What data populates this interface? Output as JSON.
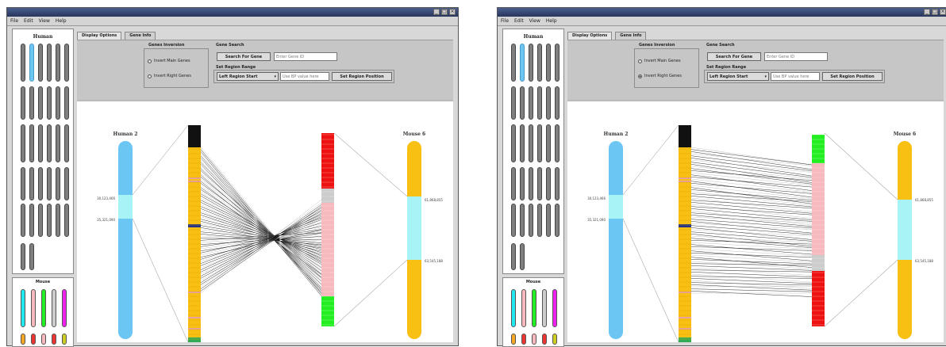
{
  "windows": [
    {
      "menu": [
        "File",
        "Edit",
        "View",
        "Help"
      ],
      "window_controls": [
        "_",
        "□",
        "×"
      ],
      "human_panel_title": "Human",
      "mouse_panel_title": "Mouse",
      "tabs": [
        "Display Options",
        "Gene Info"
      ],
      "gene_inversion": {
        "title": "Genes Inversion",
        "left": "Invert Main Genes",
        "right": "Invert Right Genes",
        "right_checked": false
      },
      "gene_search": {
        "title": "Gene Search",
        "button": "Search For Gene",
        "placeholder": "Enter Gene ID"
      },
      "region_range": {
        "title": "Set Region Range",
        "dropdown": "Left Region Start",
        "input_placeholder": "Use BP value here",
        "button": "Set Region Position"
      },
      "left_chromosome_label": "Human 2",
      "right_chromosome_label": "Mouse 6",
      "left_ticks": [
        "30,123,466",
        "35,321,090"
      ],
      "right_ticks": [
        "61,868,855",
        "63,545,188"
      ],
      "middle_right_order": "red-pink-green"
    },
    {
      "menu": [
        "File",
        "Edit",
        "View",
        "Help"
      ],
      "window_controls": [
        "_",
        "□",
        "×"
      ],
      "human_panel_title": "Human",
      "mouse_panel_title": "Mouse",
      "tabs": [
        "Display Options",
        "Gene Info"
      ],
      "gene_inversion": {
        "title": "Genes Inversion",
        "left": "Invert Main Genes",
        "right": "Invert Right Genes",
        "right_checked": true
      },
      "gene_search": {
        "title": "Gene Search",
        "button": "Search For Gene",
        "placeholder": "Enter Gene ID"
      },
      "region_range": {
        "title": "Set Region Range",
        "dropdown": "Left Region Start",
        "input_placeholder": "Use BP value here",
        "button": "Set Region Position"
      },
      "left_chromosome_label": "Human 2",
      "right_chromosome_label": "Mouse 6",
      "left_ticks": [
        "30,123,466",
        "35,321,090"
      ],
      "right_ticks": [
        "61,868,855",
        "63,545,188"
      ],
      "middle_right_order": "green-pink-red"
    }
  ],
  "colors": {
    "human_blue": "#6cc6f4",
    "mouse_orange": "#f9c014",
    "highlight_cyan": "#a8f3f5",
    "red": "#ee1111",
    "pink": "#f7b9bd",
    "green": "#22ee22",
    "titlebar": "#27355c"
  }
}
